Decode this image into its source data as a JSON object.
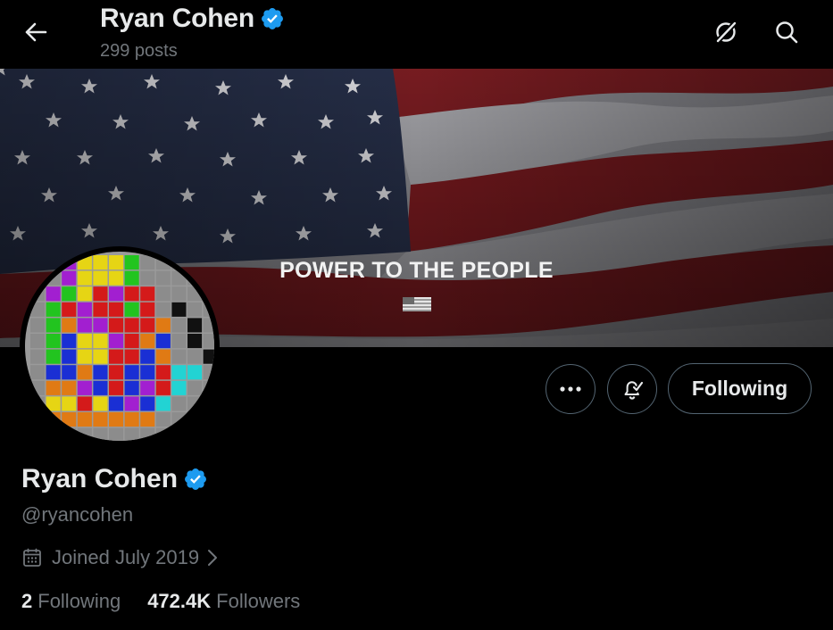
{
  "header": {
    "name": "Ryan Cohen",
    "posts_count": "299 posts"
  },
  "banner": {
    "text": "POWER TO THE PEOPLE"
  },
  "actions": {
    "more_icon": "more-dots-icon",
    "notify_icon": "bell-check-icon",
    "follow_label": "Following"
  },
  "profile": {
    "name": "Ryan Cohen",
    "handle": "@ryancohen",
    "joined": "Joined July 2019",
    "following_count": "2",
    "following_label": "Following",
    "followers_count": "472.4K",
    "followers_label": "Followers"
  },
  "colors": {
    "verified": "#1d9bf0",
    "muted": "#71767b",
    "text": "#e7e9ea",
    "border": "#536471"
  }
}
